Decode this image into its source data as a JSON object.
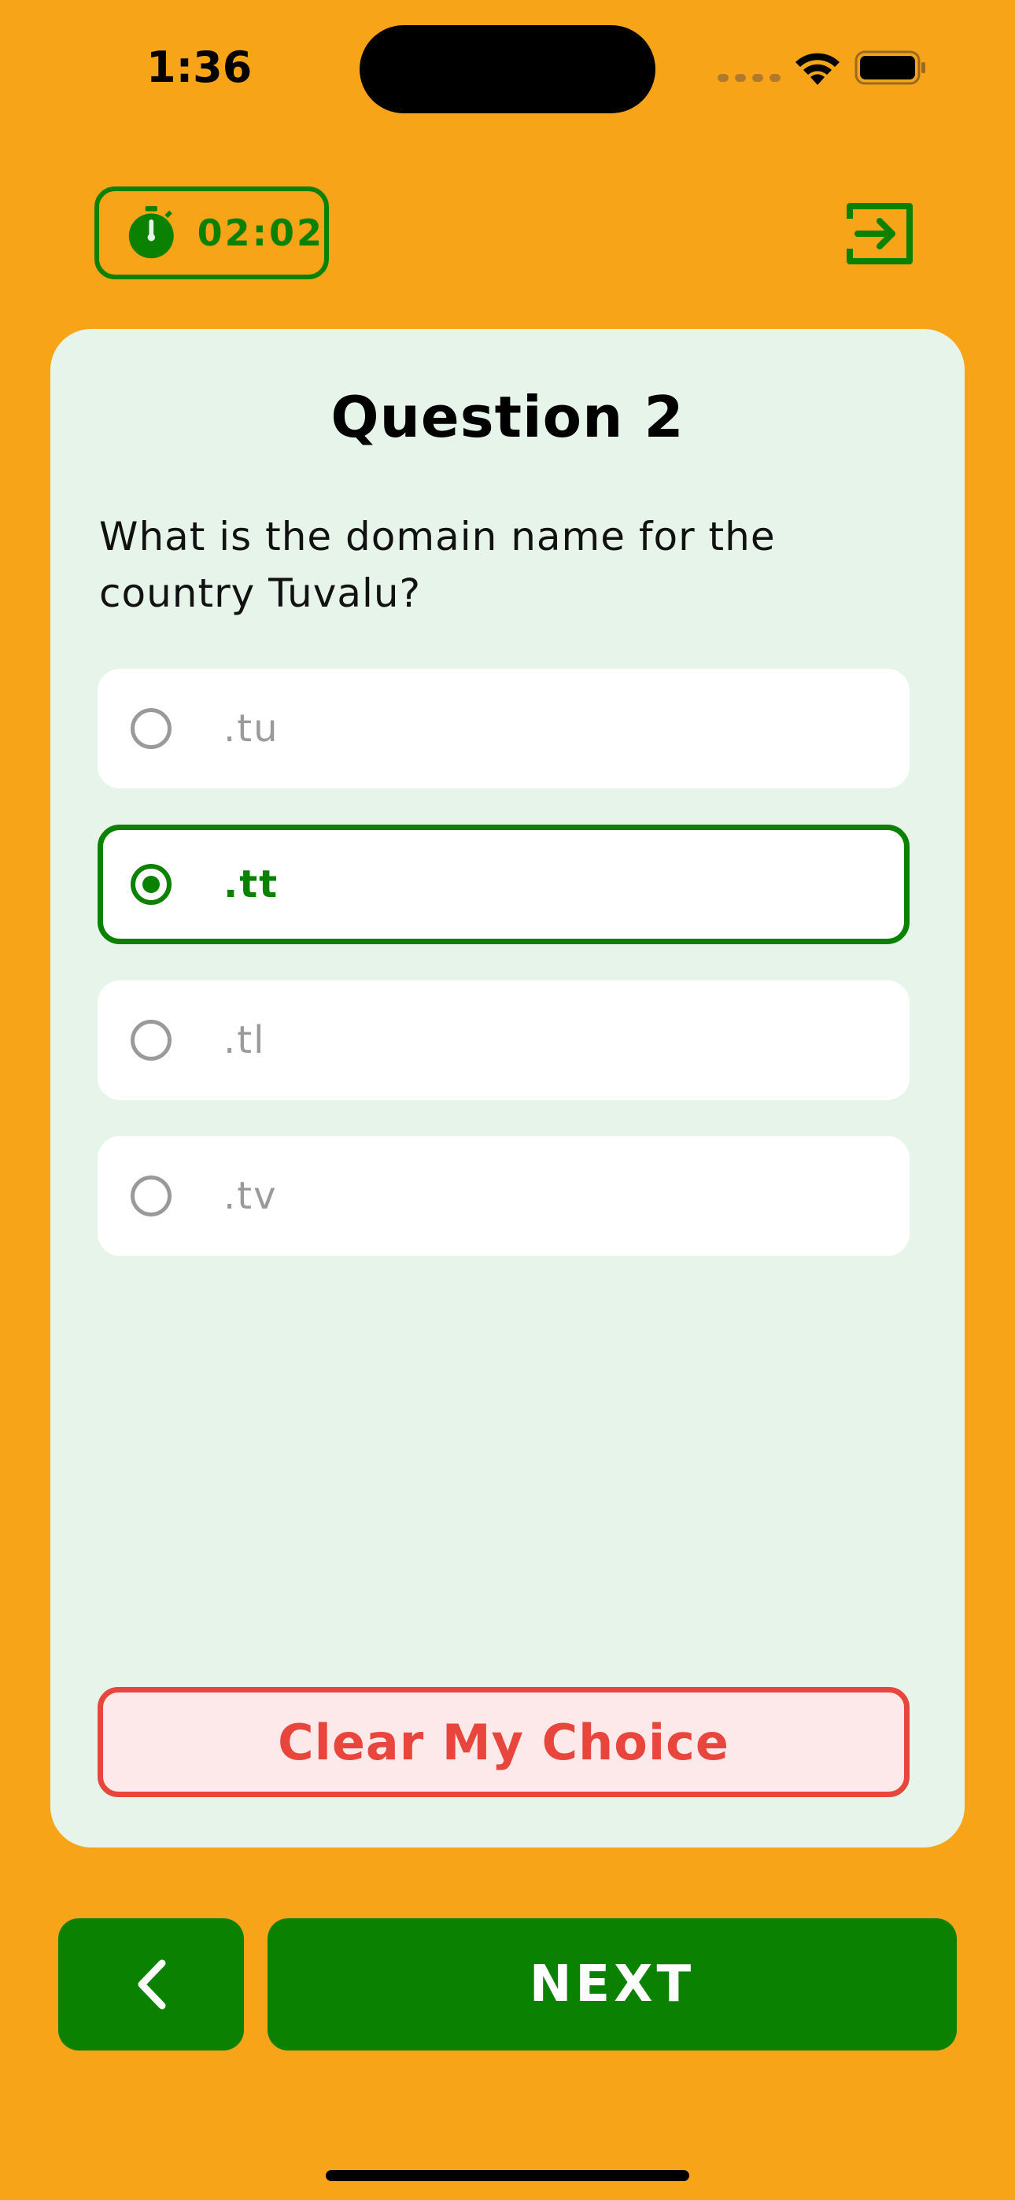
{
  "status_bar": {
    "time": "1:36"
  },
  "header": {
    "timer": "02:02",
    "timer_icon": "stopwatch-icon",
    "exit_icon": "exit-icon"
  },
  "question": {
    "title": "Question 2",
    "text": "What is the domain name for the country Tuvalu?",
    "options": [
      {
        "label": ".tu",
        "selected": false
      },
      {
        "label": ".tt",
        "selected": true
      },
      {
        "label": ".tl",
        "selected": false
      },
      {
        "label": ".tv",
        "selected": false
      }
    ],
    "clear_label": "Clear My Choice"
  },
  "navigation": {
    "back_icon": "chevron-left-icon",
    "next_label": "NEXT"
  },
  "colors": {
    "background": "#F7A418",
    "primary_green": "#0A8200",
    "card": "#E6F4E9",
    "danger": "#E8453C",
    "danger_bg": "#FDE8EA"
  }
}
